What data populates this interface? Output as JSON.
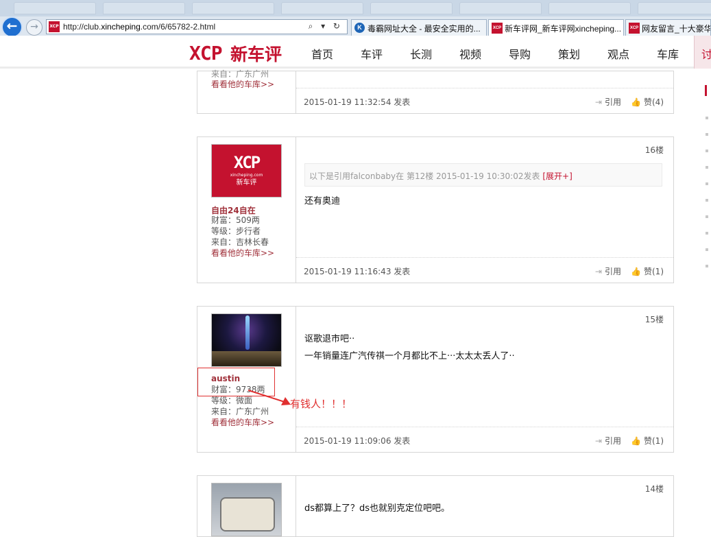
{
  "browser": {
    "url_prefix": "http://club.",
    "url_domain": "xincheping",
    "url_suffix": ".com/6/65782-2.html",
    "address_icons": "⌕ ▾ ↻",
    "tabs": [
      {
        "label": "毒霸网址大全 - 最安全实用的..."
      },
      {
        "label": "新车评网_新车评网xincheping..."
      },
      {
        "label": "网友留言_十大豪华"
      }
    ],
    "favicon_text": "XCP"
  },
  "site": {
    "logo_mark": "XCP",
    "logo_name": "新车评",
    "nav": [
      "首页",
      "车评",
      "长测",
      "视频",
      "导购",
      "策划",
      "观点",
      "车库",
      "讨"
    ]
  },
  "posts": {
    "p13": {
      "user_from": "来自：广东广州",
      "garage_link": "看看他的车库>>",
      "time": "2015-01-19 11:32:54 发表",
      "quote_btn": "引用",
      "like_btn": "赞(4)"
    },
    "p16": {
      "floor": "16楼",
      "avatar_mark": "XCP",
      "avatar_site": "xincheping.com",
      "avatar_name": "新车评",
      "username": "自由24自在",
      "wealth": "财富：509两",
      "level": "等级：步行者",
      "from": "来自：吉林长春",
      "garage_link": "看看他的车库>>",
      "quote_text": "以下是引用falconbaby在 第12楼 2015-01-19 10:30:02发表",
      "quote_expand": "[展开+]",
      "content": "还有奥迪",
      "time": "2015-01-19 11:16:43 发表",
      "quote_btn": "引用",
      "like_btn": "赞(1)"
    },
    "p15": {
      "floor": "15楼",
      "username": "austin",
      "wealth": "财富：9738两",
      "level": "等级：微面",
      "from": "来自：广东广州",
      "garage_link": "看看他的车库>>",
      "content_1": "讴歌退市吧··",
      "content_2": "一年销量连广汽传祺一个月都比不上···太太太丢人了··",
      "time": "2015-01-19 11:09:06 发表",
      "quote_btn": "引用",
      "like_btn": "赞(1)"
    },
    "p14": {
      "floor": "14楼",
      "content": "ds都算上了？ds也就别克定位吧吧。"
    }
  },
  "annotation": {
    "text": "有钱人！！！",
    "color": "#e03030"
  },
  "colors": {
    "brand": "#c4122f",
    "username": "#a0303a"
  }
}
